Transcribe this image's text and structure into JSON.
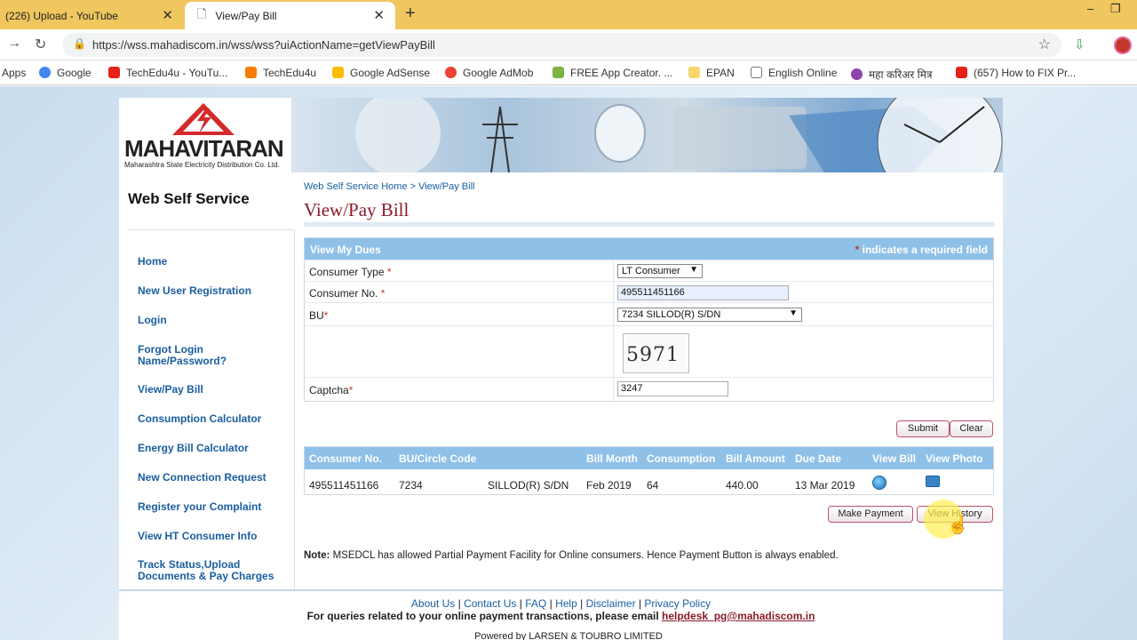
{
  "browser": {
    "tabs": [
      {
        "title": "(226) Upload - YouTube"
      },
      {
        "title": "View/Pay Bill"
      }
    ],
    "url": "https://wss.mahadiscom.in/wss/wss?uiActionName=getViewPayBill",
    "bookmarks": [
      {
        "label": "Apps",
        "color": ""
      },
      {
        "label": "Google",
        "color": "#4285f4"
      },
      {
        "label": "TechEdu4u - YouTu...",
        "color": "#e62117"
      },
      {
        "label": "TechEdu4u",
        "color": "#f57d00"
      },
      {
        "label": "Google AdSense",
        "color": "#fbbc04"
      },
      {
        "label": "Google AdMob",
        "color": "#ea4335"
      },
      {
        "label": "FREE App Creator. ...",
        "color": "#7cb342"
      },
      {
        "label": "EPAN",
        "color": "#f9d56e"
      },
      {
        "label": "English Online",
        "color": "#ffffff"
      },
      {
        "label": "महा करिअर मित्र",
        "color": "#8e44ad"
      },
      {
        "label": "(657) How to FIX Pr...",
        "color": "#e62117"
      }
    ]
  },
  "site": {
    "logo_name": "MAHAVITARAN",
    "logo_sub": "Maharashtra State Electricity Distribution Co. Ltd.",
    "title": "Web Self Service",
    "breadcrumb": "Web Self Service Home  >  View/Pay Bill",
    "page_title": "View/Pay Bill"
  },
  "sidebar": {
    "items": [
      "Home",
      "New User Registration",
      "Login",
      "Forgot Login Name/Password?",
      "View/Pay Bill",
      "Consumption Calculator",
      "Energy Bill Calculator",
      "New Connection Request",
      "Register your Complaint",
      "View HT Consumer Info",
      "Track Status,Upload Documents & Pay Charges"
    ]
  },
  "form": {
    "header": "View My Dues",
    "required_note": "indicates a required field",
    "consumer_type_label": "Consumer Type",
    "consumer_type_value": "LT Consumer",
    "consumer_no_label": "Consumer No.",
    "consumer_no_value": "495511451166",
    "bu_label": "BU",
    "bu_value": "7234 SILLOD(R) S/DN",
    "captcha_image_text": "5971",
    "captcha_label": "Captcha",
    "captcha_value": "3247",
    "submit_label": "Submit",
    "clear_label": "Clear"
  },
  "bills": {
    "columns": [
      "Consumer No.",
      "BU/Circle Code",
      "Bill Month",
      "Consumption",
      "Bill Amount",
      "Due Date",
      "View Bill",
      "View Photo"
    ],
    "row": {
      "consumer_no": "495511451166",
      "bu_code": "7234",
      "circle": "SILLOD(R) S/DN",
      "bill_month": "Feb 2019",
      "consumption": "64",
      "amount": "440.00",
      "due_date": "13 Mar 2019"
    },
    "make_payment_label": "Make Payment",
    "view_history_label": "View History"
  },
  "note": {
    "prefix": "Note:",
    "text": " MSEDCL has allowed Partial Payment Facility for Online consumers. Hence Payment Button is always enabled."
  },
  "footer": {
    "links": [
      "About Us",
      "Contact Us",
      "FAQ",
      "Help",
      "Disclaimer",
      "Privacy Policy"
    ],
    "mail_text": "For queries related to your online payment transactions, please email ",
    "mail_link": "helpdesk_pg@mahadiscom.in",
    "powered": "Powered by LARSEN & TOUBRO LIMITED"
  }
}
